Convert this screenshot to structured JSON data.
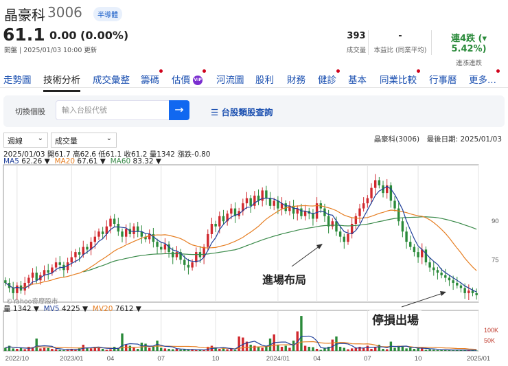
{
  "header": {
    "name": "晶豪科",
    "code": "3006",
    "sector": "半導體",
    "price": "61.1",
    "change": "0.00 (0.00%)",
    "updated": "開盤 | 2025/01/03 10:00 更新"
  },
  "stats": [
    {
      "value": "393",
      "label": "成交量"
    },
    {
      "value": "-",
      "label": "本益比 (同業平均)"
    },
    {
      "value": "連4跌 (▾ 5.42%)",
      "label": "連漲連跌"
    }
  ],
  "tabs": [
    {
      "label": "走勢圖",
      "dot": false
    },
    {
      "label": "技術分析",
      "dot": false,
      "active": true
    },
    {
      "label": "成交彙整",
      "dot": false
    },
    {
      "label": "籌碼",
      "dot": true
    },
    {
      "label": "估價",
      "dot": true,
      "vip": "VIP"
    },
    {
      "label": "河流圖",
      "dot": false
    },
    {
      "label": "股利",
      "dot": false
    },
    {
      "label": "財務",
      "dot": false
    },
    {
      "label": "健診",
      "dot": true
    },
    {
      "label": "基本",
      "dot": false
    },
    {
      "label": "同業比較",
      "dot": true
    },
    {
      "label": "行事曆",
      "dot": false
    },
    {
      "label": "更多...",
      "dot": true
    }
  ],
  "search": {
    "label": "切換個股",
    "placeholder": "輸入台股代號",
    "button": "→",
    "category_link": "☰ 台股類股查詢"
  },
  "controls": {
    "period": "週線",
    "indicator": "成交量",
    "last_date": "晶豪科(3006)　最後日期: 2025/01/03"
  },
  "ohlc": "2025/01/03 開61.7 高62.6 低61.1 收61.2 量1342 漲跌-0.80",
  "ma": {
    "ma5_label": "MA5",
    "ma5": "62.26 ▼",
    "ma20_label": "MA20",
    "ma20": "67.61 ▼",
    "ma60_label": "MA60",
    "ma60": "83.32 ▼"
  },
  "vol_legend": {
    "label": "量",
    "value": "1342 ▼",
    "mv5_label": "MV5",
    "mv5": "4225 ▼",
    "mv20_label": "MV20",
    "mv20": "7612 ▼"
  },
  "watermark": "©Yahoo奇摩股市",
  "annotations": {
    "entry": "進場布局",
    "exit": "停損出場"
  },
  "colors": {
    "up": "#d0282e",
    "down": "#2a8a3a",
    "ma5": "#1f3f99",
    "ma20": "#e67e22",
    "ma60": "#3a8a4a",
    "accent": "#1168f0"
  },
  "chart_data": {
    "type": "candlestick",
    "price_ticks": [
      90,
      75
    ],
    "price_range": [
      58.5,
      112
    ],
    "volume_ticks": [
      "100K",
      "50K"
    ],
    "volume_tick_values": [
      100,
      50
    ],
    "volume_range": [
      0,
      197
    ],
    "x_ticks": [
      {
        "label": "2022/10",
        "week": 3
      },
      {
        "label": "2023/01",
        "week": 17
      },
      {
        "label": "04",
        "week": 27
      },
      {
        "label": "07",
        "week": 40
      },
      {
        "label": "10",
        "week": 54
      },
      {
        "label": "2024/01",
        "week": 70
      },
      {
        "label": "04",
        "week": 80
      },
      {
        "label": "07",
        "week": 93
      },
      {
        "label": "10",
        "week": 106
      },
      {
        "label": "2025/01",
        "week": 122
      }
    ],
    "close": [
      66,
      64,
      62,
      65,
      63,
      66,
      68,
      70,
      67,
      69,
      71,
      70,
      72,
      74,
      73,
      71,
      74,
      76,
      78,
      77,
      80,
      79,
      82,
      84,
      86,
      85,
      88,
      91,
      89,
      86,
      84,
      87,
      85,
      88,
      86,
      84,
      83,
      85,
      82,
      80,
      79,
      81,
      78,
      76,
      78,
      75,
      73,
      72,
      74,
      78,
      76,
      80,
      85,
      89,
      88,
      92,
      90,
      93,
      95,
      92,
      94,
      97,
      99,
      96,
      100,
      98,
      102,
      99,
      96,
      98,
      95,
      97,
      94,
      96,
      93,
      95,
      92,
      94,
      93,
      91,
      97,
      95,
      92,
      88,
      90,
      86,
      84,
      82,
      85,
      89,
      92,
      95,
      97,
      99,
      103,
      106,
      104,
      101,
      104,
      98,
      95,
      90,
      86,
      82,
      80,
      78,
      76,
      79,
      74,
      72,
      71,
      70,
      69,
      68,
      67,
      66,
      65,
      64,
      62,
      63,
      62,
      61.2
    ],
    "volume_k": [
      15,
      25,
      12,
      10,
      14,
      8,
      20,
      18,
      60,
      12,
      15,
      14,
      10,
      8,
      5,
      4,
      6,
      10,
      6,
      12,
      30,
      15,
      12,
      20,
      18,
      10,
      5,
      8,
      20,
      15,
      85,
      30,
      25,
      15,
      10,
      40,
      35,
      15,
      20,
      50,
      15,
      12,
      10,
      8,
      10,
      6,
      8,
      5,
      6,
      4,
      5,
      4,
      20,
      25,
      15,
      10,
      12,
      8,
      10,
      5,
      70,
      65,
      45,
      30,
      25,
      20,
      15,
      25,
      60,
      80,
      30,
      20,
      25,
      15,
      50,
      95,
      170,
      25,
      20,
      18,
      10,
      5,
      15,
      20,
      55,
      70,
      20,
      15,
      8,
      12,
      15,
      20,
      15,
      25,
      10,
      20,
      30,
      10,
      8,
      45,
      15,
      25,
      20,
      12,
      15,
      10,
      12,
      18,
      5,
      8,
      6,
      4,
      5,
      4,
      6,
      3,
      4,
      5,
      3,
      4,
      3,
      1.3
    ]
  }
}
